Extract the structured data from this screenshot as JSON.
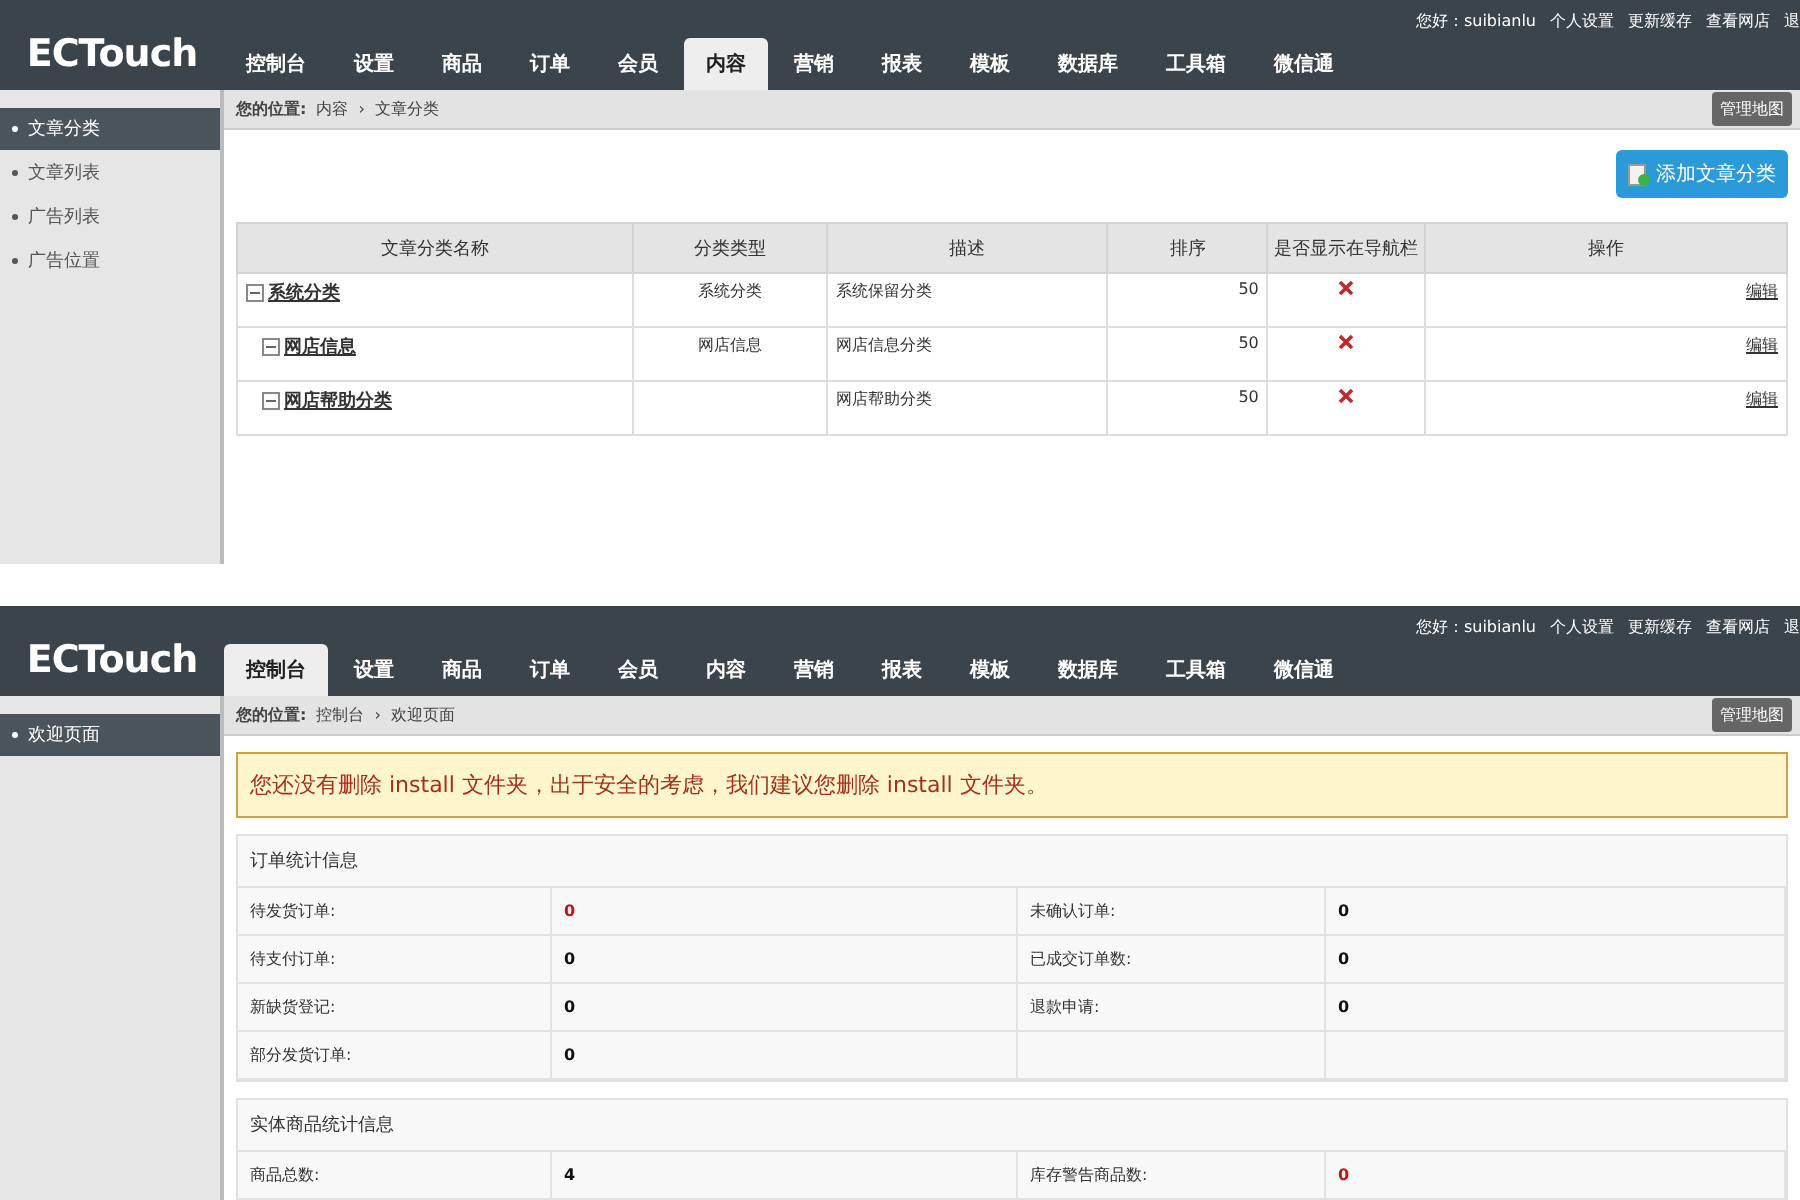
{
  "screens": [
    {
      "logo": "ECTouch",
      "nav": [
        {
          "label": "控制台",
          "selected": false
        },
        {
          "label": "设置",
          "selected": false
        },
        {
          "label": "商品",
          "selected": false
        },
        {
          "label": "订单",
          "selected": false
        },
        {
          "label": "会员",
          "selected": false
        },
        {
          "label": "内容",
          "selected": true
        },
        {
          "label": "营销",
          "selected": false
        },
        {
          "label": "报表",
          "selected": false
        },
        {
          "label": "模板",
          "selected": false
        },
        {
          "label": "数据库",
          "selected": false
        },
        {
          "label": "工具箱",
          "selected": false
        },
        {
          "label": "微信通",
          "selected": false
        }
      ],
      "user_links": [
        "您好：suibianlu",
        "个人设置",
        "更新缓存",
        "查看网店",
        "退"
      ],
      "breadcrumb": {
        "label": "您的位置:",
        "separator": "›",
        "path": [
          "内容",
          "文章分类"
        ]
      },
      "map_button": "管理地图",
      "sidebar": [
        {
          "label": "文章分类",
          "selected": true
        },
        {
          "label": "文章列表",
          "selected": false
        },
        {
          "label": "广告列表",
          "selected": false
        },
        {
          "label": "广告位置",
          "selected": false
        }
      ],
      "add_button": "添加文章分类",
      "table": {
        "columns": [
          "文章分类名称",
          "分类类型",
          "描述",
          "排序",
          "是否显示在导航栏",
          "操作"
        ],
        "rows": [
          {
            "name": "系统分类",
            "expanded": true,
            "type": "系统分类",
            "description": "系统保留分类",
            "sort": "50",
            "show_in_nav": false,
            "action": "编辑",
            "children": [
              {
                "name": "网店信息",
                "expanded": true,
                "type": "网店信息",
                "description": "网店信息分类",
                "sort": "50",
                "show_in_nav": false,
                "action": "编辑"
              },
              {
                "name": "网店帮助分类",
                "expanded": true,
                "description": "网店帮助分类",
                "sort": "50",
                "show_in_nav": false,
                "action": "编辑"
              }
            ]
          }
        ]
      }
    },
    {
      "logo": "ECTouch",
      "nav": [
        {
          "label": "控制台",
          "selected": true
        },
        {
          "label": "设置",
          "selected": false
        },
        {
          "label": "商品",
          "selected": false
        },
        {
          "label": "订单",
          "selected": false
        },
        {
          "label": "会员",
          "selected": false
        },
        {
          "label": "内容",
          "selected": false
        },
        {
          "label": "营销",
          "selected": false
        },
        {
          "label": "报表",
          "selected": false
        },
        {
          "label": "模板",
          "selected": false
        },
        {
          "label": "数据库",
          "selected": false
        },
        {
          "label": "工具箱",
          "selected": false
        },
        {
          "label": "微信通",
          "selected": false
        }
      ],
      "user_links": [
        "您好：suibianlu",
        "个人设置",
        "更新缓存",
        "查看网店",
        "退"
      ],
      "breadcrumb": {
        "label": "您的位置:",
        "separator": "›",
        "path": [
          "控制台",
          "欢迎页面"
        ]
      },
      "map_button": "管理地图",
      "sidebar": [
        {
          "label": "欢迎页面",
          "selected": true
        }
      ],
      "notice": "您还没有删除 install 文件夹，出于安全的考虑，我们建议您删除 install 文件夹。",
      "sections": [
        {
          "title": "订单统计信息",
          "rows": [
            [
              {
                "label": "待发货订单:",
                "value": "0",
                "alert": true
              },
              {
                "label": "未确认订单:",
                "value": "0",
                "alert": false
              }
            ],
            [
              {
                "label": "待支付订单:",
                "value": "0",
                "alert": false
              },
              {
                "label": "已成交订单数:",
                "value": "0",
                "alert": false
              }
            ],
            [
              {
                "label": "新缺货登记:",
                "value": "0",
                "alert": false
              },
              {
                "label": "退款申请:",
                "value": "0",
                "alert": false
              }
            ],
            [
              {
                "label": "部分发货订单:",
                "value": "0",
                "alert": false
              }
            ]
          ]
        },
        {
          "title": "实体商品统计信息",
          "rows": [
            [
              {
                "label": "商品总数:",
                "value": "4",
                "alert": false
              },
              {
                "label": "库存警告商品数:",
                "value": "0",
                "alert": true
              }
            ]
          ]
        }
      ]
    }
  ]
}
